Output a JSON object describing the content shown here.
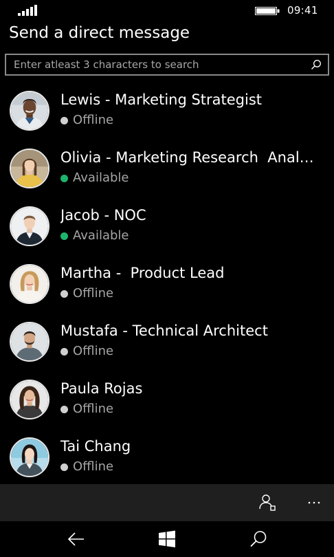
{
  "status_bar": {
    "time": "09:41",
    "signal_bars": 5,
    "battery_level": 0.95
  },
  "header": {
    "title": "Send a direct message"
  },
  "search": {
    "placeholder": "Enter atleast 3 characters to search",
    "value": "",
    "icon": "search-icon"
  },
  "colors": {
    "available": "#1db56e",
    "offline": "#a6a6a6",
    "app_bar": "#1f1f1f"
  },
  "contacts": [
    {
      "name": "Lewis - Marketing Strategist",
      "status": "Offline"
    },
    {
      "name": "Olivia - Marketing Research  Analyst",
      "status": "Available"
    },
    {
      "name": "Jacob - NOC",
      "status": "Available"
    },
    {
      "name": "Martha -  Product Lead",
      "status": "Offline"
    },
    {
      "name": "Mustafa - Technical Architect",
      "status": "Offline"
    },
    {
      "name": "Paula Rojas",
      "status": "Offline"
    },
    {
      "name": "Tai Chang",
      "status": "Offline"
    }
  ],
  "app_bar": {
    "buttons": [
      {
        "icon": "add-contact-icon"
      },
      {
        "icon": "more-icon"
      }
    ]
  },
  "nav_bar": {
    "buttons": [
      {
        "icon": "back-arrow-icon"
      },
      {
        "icon": "windows-icon"
      },
      {
        "icon": "search-icon"
      }
    ]
  }
}
